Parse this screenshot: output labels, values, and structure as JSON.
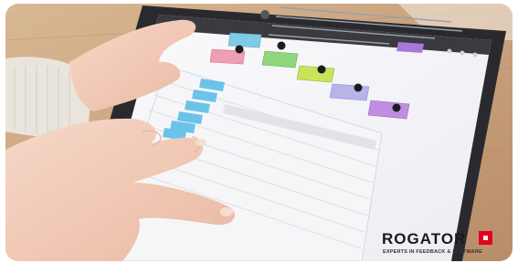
{
  "photo": {
    "subject": "tablet-survey-interaction",
    "icons": [
      "hand-icon",
      "tablet-icon",
      "info-icon",
      "close-icon"
    ]
  },
  "brand": {
    "wordmark": "ROGATOR",
    "tagline": "EXPERTS IN FEEDBACK & SOFTWARE",
    "accent_color": "#e2001a"
  },
  "colors": {
    "table_wood": "#c9a27d",
    "card_blue": "#7ecbe6",
    "card_green": "#8fd67c",
    "card_lime": "#c9e35a",
    "card_lavender": "#b7b4e8",
    "card_violet": "#c08ee0",
    "card_pink": "#ee9fb3",
    "skin": "#f2c9b6"
  }
}
